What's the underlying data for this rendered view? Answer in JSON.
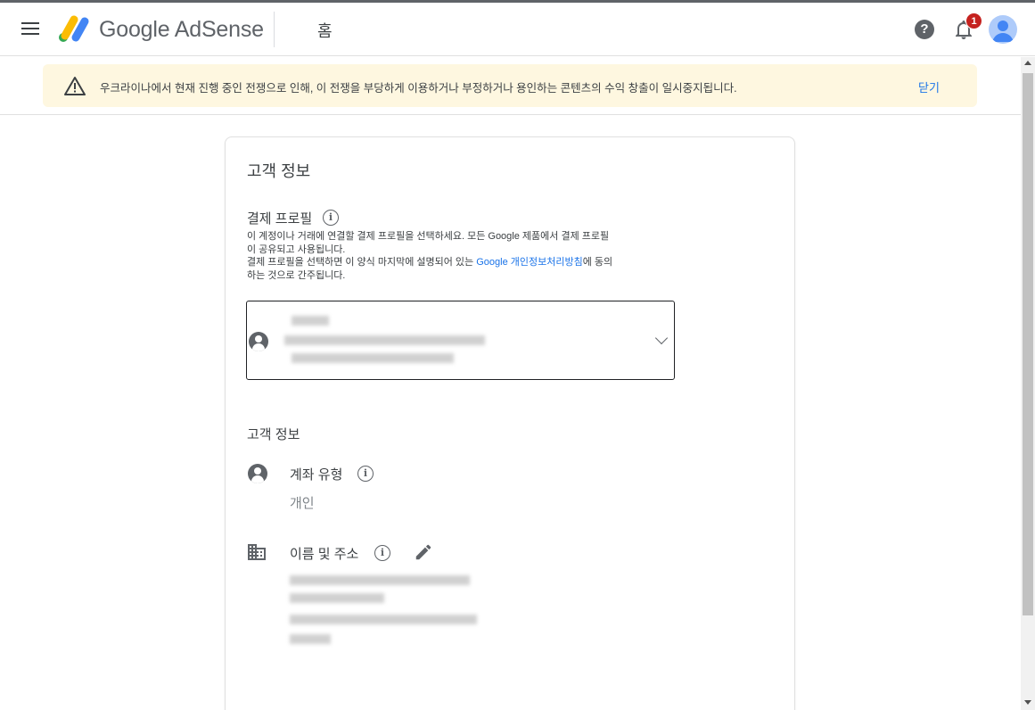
{
  "header": {
    "brand": "Google AdSense",
    "page_title": "홈",
    "help_label": "?",
    "notification_count": "1"
  },
  "banner": {
    "message": "우크라이나에서 현재 진행 중인 전쟁으로 인해, 이 전쟁을 부당하게 이용하거나 부정하거나 용인하는 콘텐츠의 수익 창출이 일시중지됩니다.",
    "close_label": "닫기"
  },
  "card": {
    "title": "고객 정보",
    "payment_profile": {
      "label": "결제 프로필",
      "desc_line1": "이 계정이나 거래에 연결할 결제 프로필을 선택하세요. 모든 Google 제품에서 결제 프로필",
      "desc_line2": "이 공유되고 사용됩니다.",
      "desc_line3_before": "결제 프로필을 선택하면 이 양식 마지막에 설명되어 있는 ",
      "desc_link": "Google 개인정보처리방침",
      "desc_line3_after": "에 동의",
      "desc_line4": "하는 것으로 간주됩니다."
    },
    "customer_info": {
      "heading": "고객 정보",
      "account_type_label": "계좌 유형",
      "account_type_value": "개인",
      "name_address_label": "이름 및 주소"
    }
  },
  "colors": {
    "accent": "#1a73e8",
    "banner_bg": "#fef7e0",
    "badge": "#c5221f"
  }
}
